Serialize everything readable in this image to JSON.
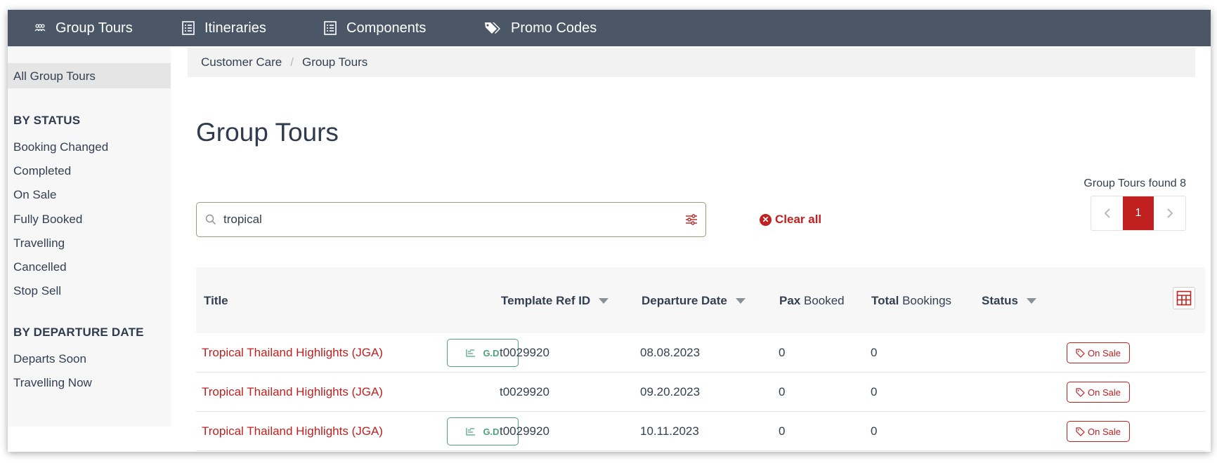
{
  "nav": {
    "items": [
      {
        "label": "Group Tours",
        "icon": "group-icon"
      },
      {
        "label": "Itineraries",
        "icon": "list-icon"
      },
      {
        "label": "Components",
        "icon": "list-icon"
      },
      {
        "label": "Promo Codes",
        "icon": "tags-icon"
      }
    ]
  },
  "sidebar": {
    "all": "All Group Tours",
    "status_heading": "BY STATUS",
    "status_items": [
      "Booking Changed",
      "Completed",
      "On Sale",
      "Fully Booked",
      "Travelling",
      "Cancelled",
      "Stop Sell"
    ],
    "date_heading": "BY DEPARTURE DATE",
    "date_items": [
      "Departs Soon",
      "Travelling Now"
    ]
  },
  "breadcrumb": [
    "Customer Care",
    "Group Tours"
  ],
  "page_title": "Group Tours",
  "search": {
    "value": "tropical",
    "placeholder": ""
  },
  "clear_all": "Clear all",
  "results": {
    "found_label": "Group Tours found 8",
    "current_page": "1"
  },
  "table": {
    "headers": {
      "title": "Title",
      "template_ref": "Template Ref ID",
      "departure": "Departure Date",
      "pax_bold": "Pax",
      "pax_rest": "Booked",
      "total_bold": "Total",
      "total_rest": "Bookings",
      "status": "Status"
    },
    "rows": [
      {
        "title": "Tropical Thailand Highlights (JGA)",
        "gd": "G.D",
        "ref": "t0029920",
        "date": "08.08.2023",
        "pax": "0",
        "total": "0",
        "status": "On Sale"
      },
      {
        "title": "Tropical Thailand Highlights (JGA)",
        "gd": "",
        "ref": "t0029920",
        "date": "09.20.2023",
        "pax": "0",
        "total": "0",
        "status": "On Sale"
      },
      {
        "title": "Tropical Thailand Highlights (JGA)",
        "gd": "G.D",
        "ref": "t0029920",
        "date": "10.11.2023",
        "pax": "0",
        "total": "0",
        "status": "On Sale"
      }
    ]
  },
  "colors": {
    "nav_bg": "#4b5767",
    "accent_red": "#c0201f",
    "gd_green": "#4ea37a"
  }
}
